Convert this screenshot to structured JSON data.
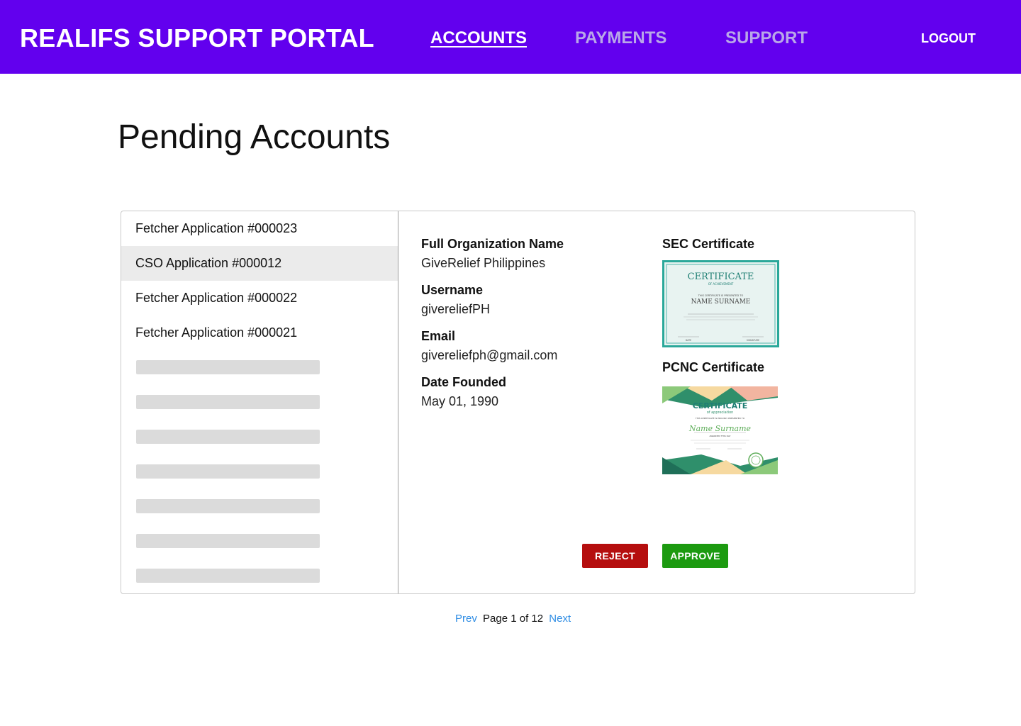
{
  "header": {
    "brand": "REALIFS SUPPORT PORTAL",
    "nav": [
      {
        "label": "ACCOUNTS",
        "active": true
      },
      {
        "label": "PAYMENTS",
        "active": false
      },
      {
        "label": "SUPPORT",
        "active": false
      }
    ],
    "logout_label": "LOGOUT",
    "background_color": "#6200ee"
  },
  "page": {
    "title": "Pending Accounts"
  },
  "applications": {
    "items": [
      {
        "label": "Fetcher Application #000023",
        "selected": false
      },
      {
        "label": "CSO Application #000012",
        "selected": true
      },
      {
        "label": "Fetcher Application #000022",
        "selected": false
      },
      {
        "label": "Fetcher Application #000021",
        "selected": false
      }
    ],
    "loading_placeholders": 7
  },
  "details": {
    "org_name_label": "Full Organization Name",
    "org_name": "GiveRelief Philippines",
    "username_label": "Username",
    "username": "givereliefPH",
    "email_label": "Email",
    "email": "givereliefph@gmail.com",
    "date_founded_label": "Date Founded",
    "date_founded": "May 01, 1990",
    "sec_label": "SEC Certificate",
    "sec_cert": {
      "title": "CERTIFICATE",
      "subtitle": "OF ACHIEVEMENT",
      "presented": "THIS CERTIFICATE IS PRESENTED TO",
      "name": "NAME SURNAME",
      "left_sign": "DATE",
      "right_sign": "SIGNATURE"
    },
    "pcnc_label": "PCNC Certificate",
    "pcnc_cert": {
      "title": "CERTIFICATE",
      "subtitle": "of appreciation",
      "presented": "THIS CERTIFICATE IS PROUDLY PRESENTED TO",
      "name": "Name Surname",
      "awarded": "AWARDED THIS DAY"
    },
    "reject_label": "REJECT",
    "approve_label": "APPROVE",
    "reject_color": "#b50e0e",
    "approve_color": "#1c9a10"
  },
  "pagination": {
    "prev": "Prev",
    "status": "Page 1 of 12",
    "next": "Next",
    "current_page": 1,
    "total_pages": 12
  }
}
